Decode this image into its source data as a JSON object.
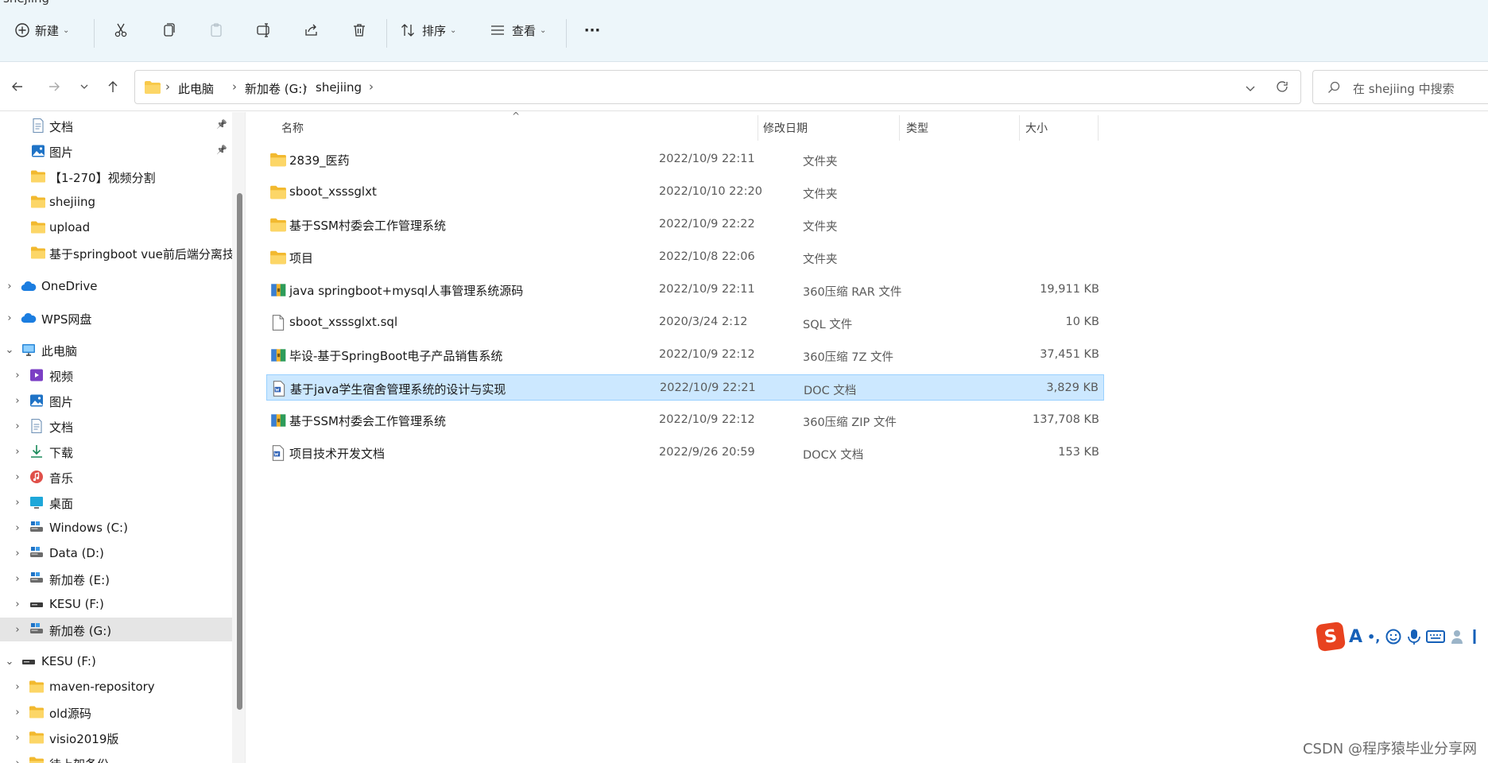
{
  "window": {
    "title": "shejiing"
  },
  "toolbar": {
    "new_label": "新建",
    "sort_label": "排序",
    "view_label": "查看",
    "more_label": "···"
  },
  "address": {
    "crumbs": [
      "此电脑",
      "新加卷 (G:)",
      "shejiing"
    ],
    "search_placeholder": "在 shejiing 中搜索"
  },
  "sidebar": {
    "items": [
      {
        "label": "文档",
        "pinned": true,
        "icon": "document-icon"
      },
      {
        "label": "图片",
        "pinned": true,
        "icon": "picture-icon"
      },
      {
        "label": "【1-270】视频分割",
        "icon": "folder-icon"
      },
      {
        "label": "shejiing",
        "icon": "folder-icon"
      },
      {
        "label": "upload",
        "icon": "folder-icon"
      },
      {
        "label": "基于springboot vue前后端分离技",
        "icon": "folder-icon"
      },
      {
        "label": "OneDrive",
        "icon": "cloud-icon"
      },
      {
        "label": "WPS网盘",
        "icon": "cloud-icon"
      },
      {
        "label": "此电脑",
        "icon": "computer-icon"
      },
      {
        "label": "视频",
        "icon": "video-icon"
      },
      {
        "label": "图片",
        "icon": "picture-icon"
      },
      {
        "label": "文档",
        "icon": "document-icon"
      },
      {
        "label": "下载",
        "icon": "download-icon"
      },
      {
        "label": "音乐",
        "icon": "music-icon"
      },
      {
        "label": "桌面",
        "icon": "desktop-icon"
      },
      {
        "label": "Windows (C:)",
        "icon": "drive-icon"
      },
      {
        "label": "Data (D:)",
        "icon": "drive-icon"
      },
      {
        "label": "新加卷 (E:)",
        "icon": "drive-icon"
      },
      {
        "label": "KESU  (F:)",
        "icon": "usb-drive-icon"
      },
      {
        "label": "新加卷 (G:)",
        "icon": "drive-icon",
        "selected": true
      },
      {
        "label": "KESU  (F:)",
        "icon": "usb-drive-icon"
      },
      {
        "label": "maven-repository",
        "icon": "folder-icon"
      },
      {
        "label": "old源码",
        "icon": "folder-icon"
      },
      {
        "label": "visio2019版",
        "icon": "folder-icon"
      },
      {
        "label": "待上架备份",
        "icon": "folder-icon"
      }
    ]
  },
  "filelist": {
    "columns": {
      "name": "名称",
      "date": "修改日期",
      "type": "类型",
      "size": "大小"
    },
    "sort_caret": "^",
    "rows": [
      {
        "name": "2839_医药",
        "date": "2022/10/9 22:11",
        "type": "文件夹",
        "size": "",
        "icon": "folder-icon"
      },
      {
        "name": "sboot_xsssglxt",
        "date": "2022/10/10 22:20",
        "type": "文件夹",
        "size": "",
        "icon": "folder-icon"
      },
      {
        "name": "基于SSM村委会工作管理系统",
        "date": "2022/10/9 22:22",
        "type": "文件夹",
        "size": "",
        "icon": "folder-icon"
      },
      {
        "name": "项目",
        "date": "2022/10/8 22:06",
        "type": "文件夹",
        "size": "",
        "icon": "folder-icon"
      },
      {
        "name": "java springboot+mysql人事管理系统源码",
        "date": "2022/10/9 22:11",
        "type": "360压缩 RAR 文件",
        "size": "19,911 KB",
        "icon": "archive-icon"
      },
      {
        "name": "sboot_xsssglxt.sql",
        "date": "2020/3/24 2:12",
        "type": "SQL 文件",
        "size": "10 KB",
        "icon": "file-icon"
      },
      {
        "name": "毕设-基于SpringBoot电子产品销售系统",
        "date": "2022/10/9 22:12",
        "type": "360压缩 7Z 文件",
        "size": "37,451 KB",
        "icon": "archive-icon"
      },
      {
        "name": "基于java学生宿舍管理系统的设计与实现",
        "date": "2022/10/9 22:21",
        "type": "DOC 文档",
        "size": "3,829 KB",
        "icon": "word-doc-icon",
        "selected": true
      },
      {
        "name": "基于SSM村委会工作管理系统",
        "date": "2022/10/9 22:12",
        "type": "360压缩 ZIP 文件",
        "size": "137,708 KB",
        "icon": "archive-icon"
      },
      {
        "name": "项目技术开发文档",
        "date": "2022/9/26 20:59",
        "type": "DOCX 文档",
        "size": "153 KB",
        "icon": "word-doc-icon"
      }
    ]
  },
  "ime": {
    "logo": "S",
    "mode": "A"
  },
  "watermark": "CSDN @程序猿毕业分享网",
  "colors": {
    "toolbar_bg": "#edf6fa",
    "selection_bg": "#cce8ff",
    "selection_border": "#99d1ff",
    "folder": "#f8c94a",
    "accent": "#1560b8"
  }
}
